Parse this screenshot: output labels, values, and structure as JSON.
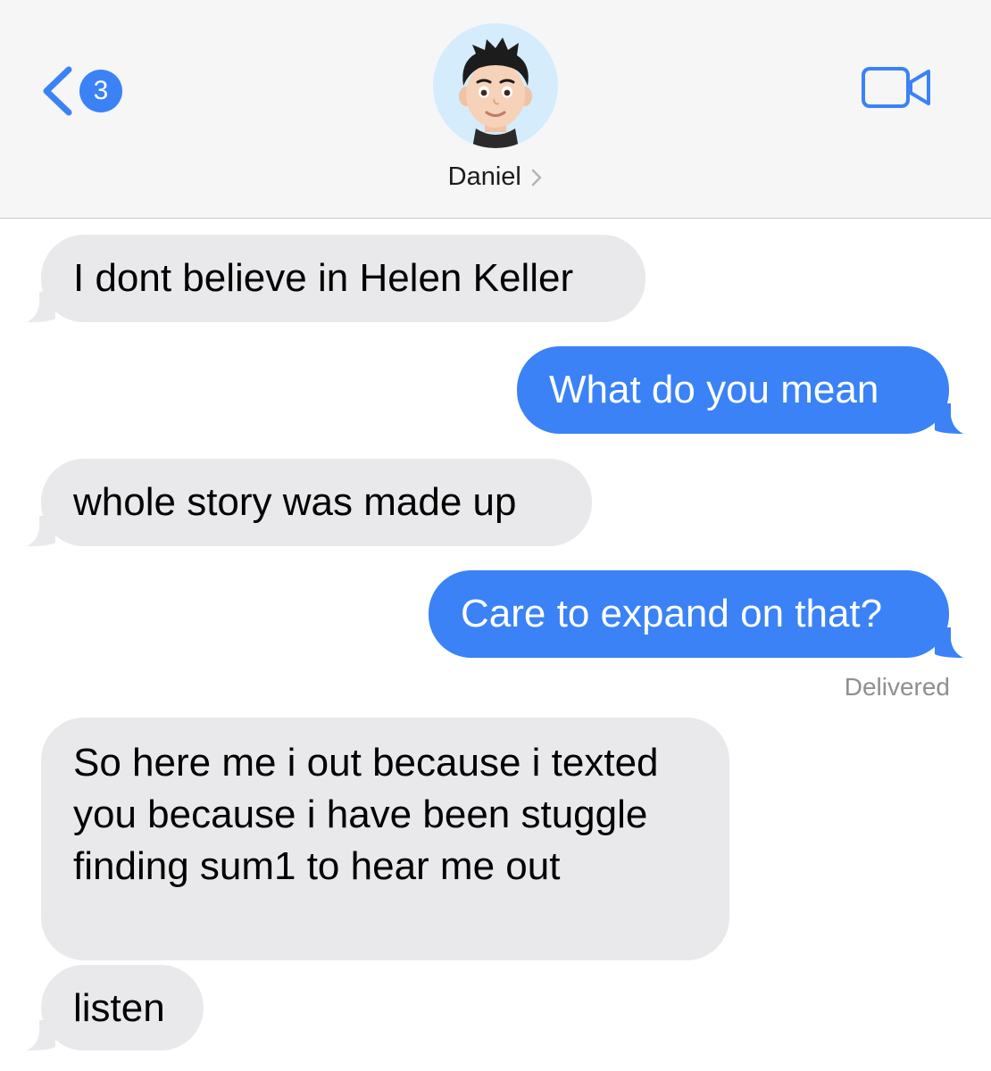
{
  "header": {
    "back_badge": "3",
    "contact_name": "Daniel"
  },
  "colors": {
    "accent": "#3a82f6",
    "incoming_bubble": "#e9e9eb",
    "header_bg": "#f6f6f6",
    "avatar_bg": "#d4ecfb",
    "delivered_text": "#8e8e93"
  },
  "icons": {
    "back": "chevron-left-icon",
    "contact_chevron": "chevron-right-icon",
    "video": "video-camera-icon",
    "avatar": "memoji-avatar"
  },
  "messages": [
    {
      "direction": "incoming",
      "text": "I dont believe in Helen Keller"
    },
    {
      "direction": "outgoing",
      "text": "What do you mean"
    },
    {
      "direction": "incoming",
      "text": "whole story was made up"
    },
    {
      "direction": "outgoing",
      "text": "Care to expand on that?"
    },
    {
      "direction": "incoming",
      "text": "So here me i out because i texted you because i have been stuggle finding sum1 to hear me out"
    },
    {
      "direction": "incoming",
      "text": "listen"
    }
  ],
  "status": {
    "delivered": "Delivered"
  }
}
